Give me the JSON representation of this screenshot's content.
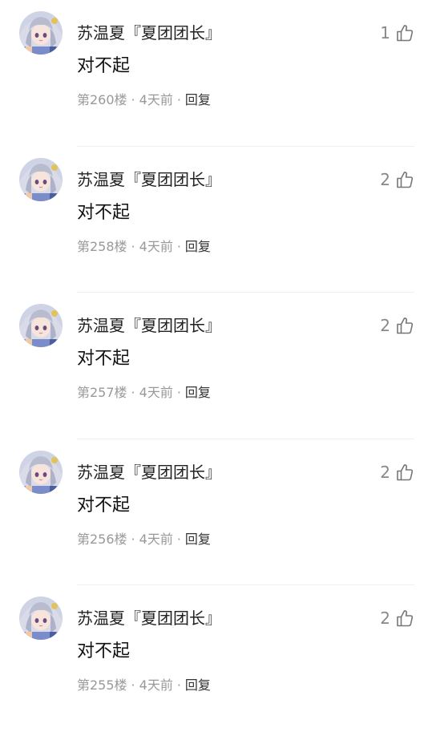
{
  "comments": [
    {
      "username": "苏温夏『夏团团长』",
      "content": "对不起",
      "floor": "第260楼",
      "time": "4天前",
      "reply": "回复",
      "likes": "1",
      "avatar_icon": "anime-girl-avatar",
      "like_icon": "thumbs-up-icon"
    },
    {
      "username": "苏温夏『夏团团长』",
      "content": "对不起",
      "floor": "第258楼",
      "time": "4天前",
      "reply": "回复",
      "likes": "2",
      "avatar_icon": "anime-girl-avatar",
      "like_icon": "thumbs-up-icon"
    },
    {
      "username": "苏温夏『夏团团长』",
      "content": "对不起",
      "floor": "第257楼",
      "time": "4天前",
      "reply": "回复",
      "likes": "2",
      "avatar_icon": "anime-girl-avatar",
      "like_icon": "thumbs-up-icon"
    },
    {
      "username": "苏温夏『夏团团长』",
      "content": "对不起",
      "floor": "第256楼",
      "time": "4天前",
      "reply": "回复",
      "likes": "2",
      "avatar_icon": "anime-girl-avatar",
      "like_icon": "thumbs-up-icon"
    },
    {
      "username": "苏温夏『夏团团长』",
      "content": "对不起",
      "floor": "第255楼",
      "time": "4天前",
      "reply": "回复",
      "likes": "2",
      "avatar_icon": "anime-girl-avatar",
      "like_icon": "thumbs-up-icon"
    }
  ],
  "meta_separator": "·",
  "colors": {
    "text_primary": "#222222",
    "text_meta": "#999999",
    "reply": "#333333",
    "like_count": "#888888",
    "divider": "#eeeeee"
  }
}
